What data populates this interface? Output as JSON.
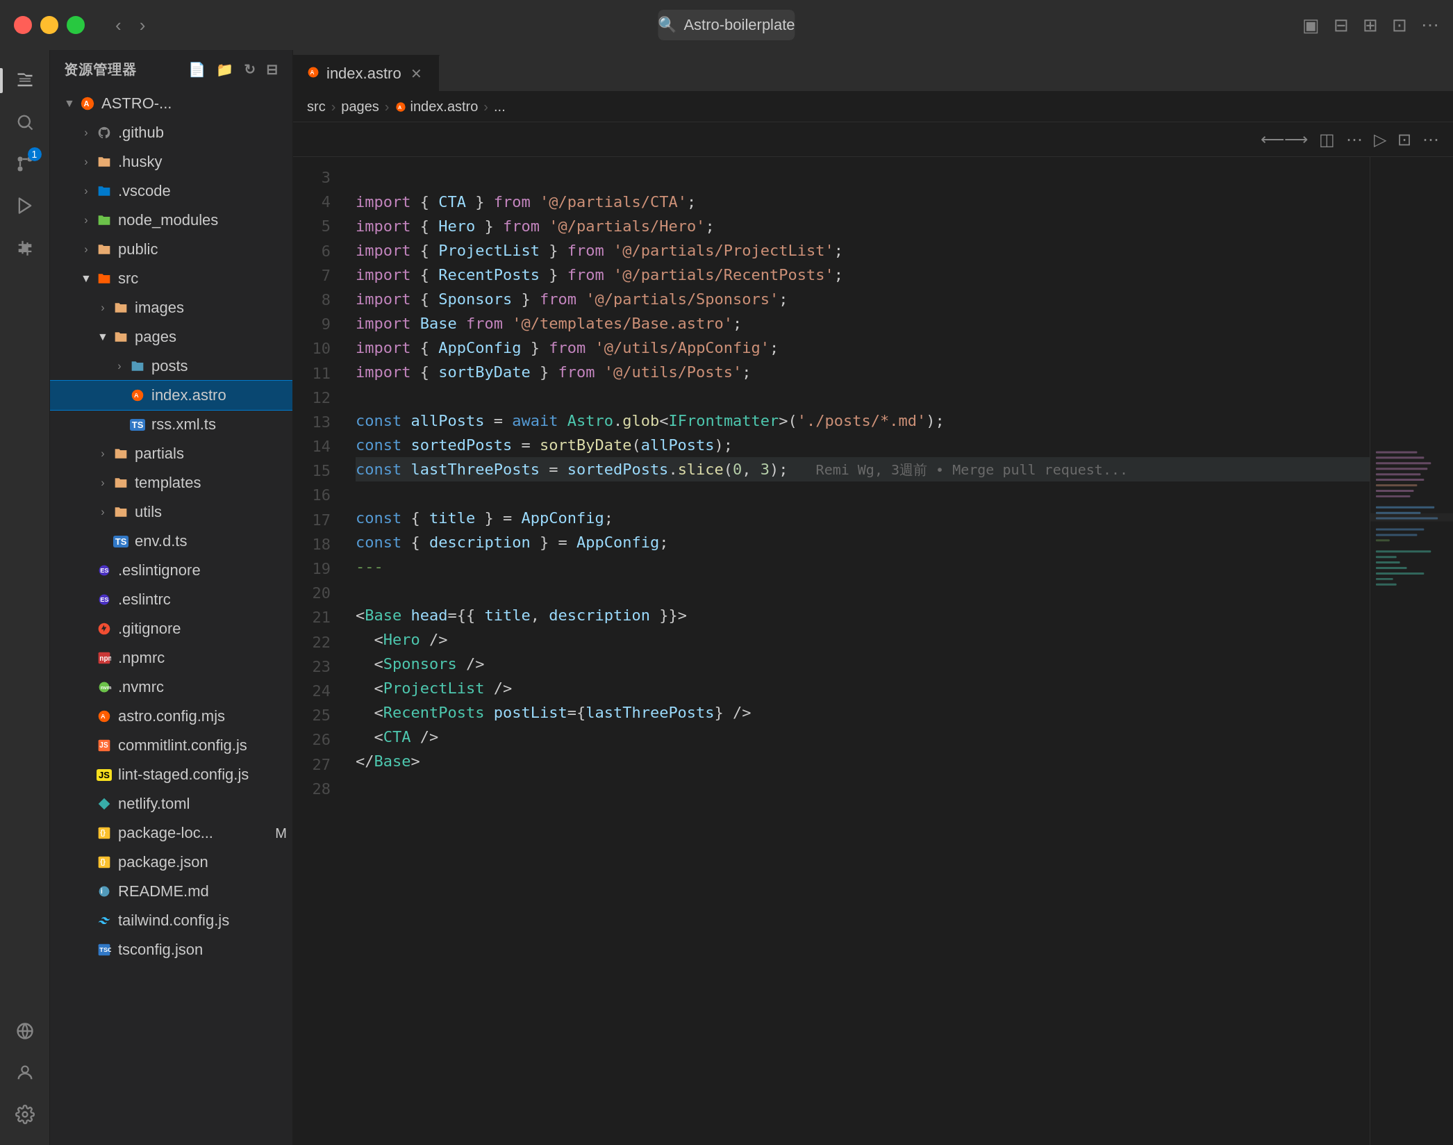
{
  "titlebar": {
    "search_placeholder": "Astro-boilerplate",
    "traffic_lights": [
      "red",
      "yellow",
      "green"
    ]
  },
  "sidebar": {
    "header": "资源管理器",
    "project_root": "ASTRO-...",
    "tree": [
      {
        "id": "github",
        "label": ".github",
        "type": "folder",
        "indent": 1,
        "expanded": false
      },
      {
        "id": "husky",
        "label": ".husky",
        "type": "folder",
        "indent": 1,
        "expanded": false
      },
      {
        "id": "vscode",
        "label": ".vscode",
        "type": "folder",
        "indent": 1,
        "expanded": false
      },
      {
        "id": "node_modules",
        "label": "node_modules",
        "type": "folder",
        "indent": 1,
        "expanded": false
      },
      {
        "id": "public",
        "label": "public",
        "type": "folder",
        "indent": 1,
        "expanded": false
      },
      {
        "id": "src",
        "label": "src",
        "type": "folder-src",
        "indent": 1,
        "expanded": true
      },
      {
        "id": "images",
        "label": "images",
        "type": "folder",
        "indent": 2,
        "expanded": false
      },
      {
        "id": "pages",
        "label": "pages",
        "type": "folder",
        "indent": 2,
        "expanded": true
      },
      {
        "id": "posts",
        "label": "posts",
        "type": "folder",
        "indent": 3,
        "expanded": false
      },
      {
        "id": "index-astro",
        "label": "index.astro",
        "type": "astro",
        "indent": 3,
        "expanded": false,
        "active": true
      },
      {
        "id": "rss-xml",
        "label": "rss.xml.ts",
        "type": "ts",
        "indent": 3,
        "expanded": false
      },
      {
        "id": "partials",
        "label": "partials",
        "type": "folder",
        "indent": 2,
        "expanded": false
      },
      {
        "id": "templates",
        "label": "templates",
        "type": "folder",
        "indent": 2,
        "expanded": false
      },
      {
        "id": "utils",
        "label": "utils",
        "type": "folder",
        "indent": 2,
        "expanded": false
      },
      {
        "id": "env-d-ts",
        "label": "env.d.ts",
        "type": "ts",
        "indent": 2,
        "expanded": false
      },
      {
        "id": "eslintignore",
        "label": ".eslintignore",
        "type": "eslint",
        "indent": 1,
        "expanded": false
      },
      {
        "id": "eslintrc",
        "label": ".eslintrc",
        "type": "eslint",
        "indent": 1,
        "expanded": false
      },
      {
        "id": "gitignore",
        "label": ".gitignore",
        "type": "git",
        "indent": 1,
        "expanded": false
      },
      {
        "id": "npmrc",
        "label": ".npmrc",
        "type": "npm",
        "indent": 1,
        "expanded": false
      },
      {
        "id": "nvmrc",
        "label": ".nvmrc",
        "type": "nvmrc",
        "indent": 1,
        "expanded": false
      },
      {
        "id": "astro-config",
        "label": "astro.config.mjs",
        "type": "astro",
        "indent": 1,
        "expanded": false
      },
      {
        "id": "commitlint",
        "label": "commitlint.config.js",
        "type": "js",
        "indent": 1,
        "expanded": false
      },
      {
        "id": "lint-staged",
        "label": "lint-staged.config.js",
        "type": "js",
        "indent": 1,
        "expanded": false
      },
      {
        "id": "netlify",
        "label": "netlify.toml",
        "type": "toml",
        "indent": 1,
        "expanded": false
      },
      {
        "id": "package-lock",
        "label": "package-loc...",
        "type": "json",
        "indent": 1,
        "expanded": false,
        "badge": "M"
      },
      {
        "id": "package-json",
        "label": "package.json",
        "type": "json",
        "indent": 1,
        "expanded": false
      },
      {
        "id": "readme",
        "label": "README.md",
        "type": "md",
        "indent": 1,
        "expanded": false
      },
      {
        "id": "tailwind",
        "label": "tailwind.config.js",
        "type": "js",
        "indent": 1,
        "expanded": false
      },
      {
        "id": "tsconfig",
        "label": "tsconfig.json",
        "type": "json",
        "indent": 1,
        "expanded": false
      }
    ]
  },
  "editor": {
    "tab_label": "index.astro",
    "breadcrumb": [
      "src",
      "pages",
      "index.astro",
      "..."
    ],
    "lines": [
      {
        "num": 3,
        "content": ""
      },
      {
        "num": 4,
        "content": "import { CTA } from '@/partials/CTA';"
      },
      {
        "num": 5,
        "content": "import { Hero } from '@/partials/Hero';"
      },
      {
        "num": 6,
        "content": "import { ProjectList } from '@/partials/ProjectList';"
      },
      {
        "num": 7,
        "content": "import { RecentPosts } from '@/partials/RecentPosts';"
      },
      {
        "num": 8,
        "content": "import { Sponsors } from '@/partials/Sponsors';"
      },
      {
        "num": 9,
        "content": "import Base from '@/templates/Base.astro';"
      },
      {
        "num": 10,
        "content": "import { AppConfig } from '@/utils/AppConfig';"
      },
      {
        "num": 11,
        "content": "import { sortByDate } from '@/utils/Posts';"
      },
      {
        "num": 12,
        "content": ""
      },
      {
        "num": 13,
        "content": "const allPosts = await Astro.glob<IFrontmatter>('./posts/*.md');"
      },
      {
        "num": 14,
        "content": "const sortedPosts = sortByDate(allPosts);"
      },
      {
        "num": 15,
        "content": "const lastThreePosts = sortedPosts.slice(0, 3);    Remi Wg, 3週前 • Merge pull request..."
      },
      {
        "num": 16,
        "content": ""
      },
      {
        "num": 17,
        "content": "const { title } = AppConfig;"
      },
      {
        "num": 18,
        "content": "const { description } = AppConfig;"
      },
      {
        "num": 19,
        "content": "---"
      },
      {
        "num": 20,
        "content": ""
      },
      {
        "num": 21,
        "content": "<Base head={{ title, description }}>"
      },
      {
        "num": 22,
        "content": "  <Hero />"
      },
      {
        "num": 23,
        "content": "  <Sponsors />"
      },
      {
        "num": 24,
        "content": "  <ProjectList />"
      },
      {
        "num": 25,
        "content": "  <RecentPosts postList={lastThreePosts} />"
      },
      {
        "num": 26,
        "content": "  <CTA />"
      },
      {
        "num": 27,
        "content": "</Base>"
      },
      {
        "num": 28,
        "content": ""
      }
    ]
  },
  "activity_bar": {
    "items": [
      {
        "id": "explorer",
        "icon": "files",
        "active": true
      },
      {
        "id": "search",
        "icon": "search"
      },
      {
        "id": "source-control",
        "icon": "git",
        "badge": "1"
      },
      {
        "id": "run",
        "icon": "run"
      },
      {
        "id": "extensions",
        "icon": "extensions"
      },
      {
        "id": "remote",
        "icon": "remote"
      },
      {
        "id": "accounts",
        "icon": "accounts"
      },
      {
        "id": "settings",
        "icon": "settings"
      }
    ]
  }
}
